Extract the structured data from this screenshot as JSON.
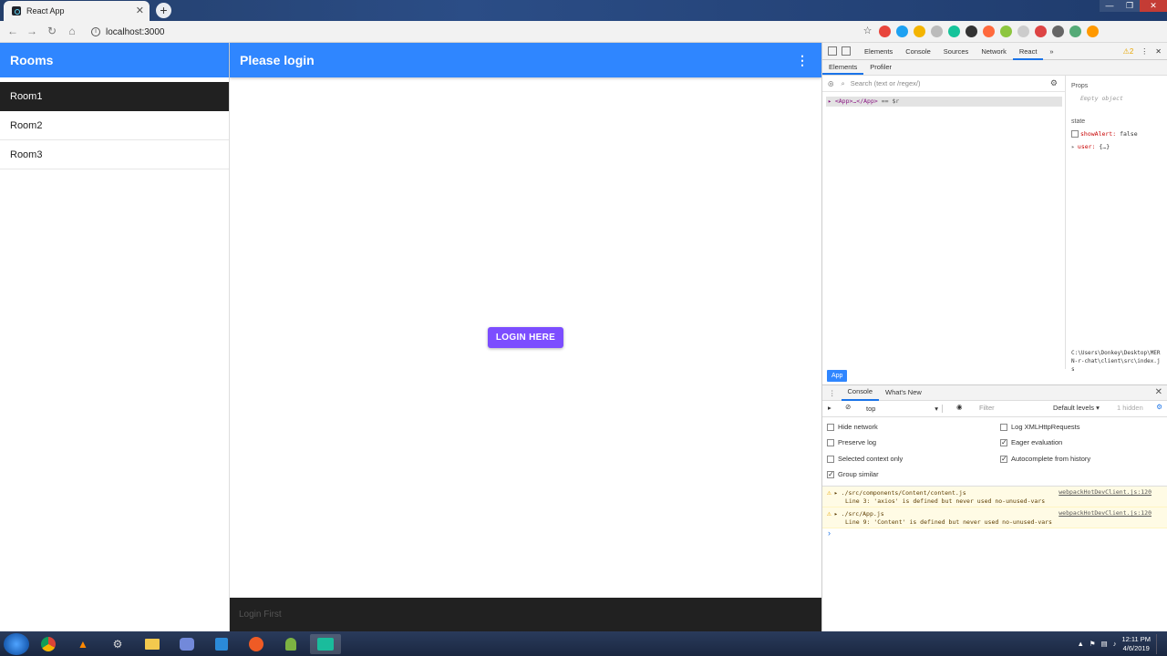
{
  "browser": {
    "tab_title": "React App",
    "tab_close": "✕",
    "new_tab": "+",
    "url": "localhost:3000",
    "window_controls": [
      "—",
      "❐",
      "✕"
    ]
  },
  "app": {
    "sidebar": {
      "title": "Rooms",
      "rooms": [
        "Room1",
        "Room2",
        "Room3"
      ],
      "active_index": 0
    },
    "main": {
      "title": "Please login",
      "login_button": "LOGIN HERE",
      "footer_text": "Login First"
    },
    "colors": {
      "header_blue": "#2f86ff",
      "button_purple": "#7c4dff",
      "dark": "#212121"
    }
  },
  "devtools": {
    "tabs": [
      "Elements",
      "Console",
      "Sources",
      "Network",
      "React"
    ],
    "active_tab": "React",
    "warning_count": "2",
    "react_subtabs": [
      "Elements",
      "Profiler"
    ],
    "search_placeholder": "Search (text or /regex/)",
    "tree_row": "<App>…</App>",
    "tree_row_suffix": "== $r",
    "props_header": "Props",
    "props_empty": "Empty object",
    "state_header": "state",
    "state_showAlert_key": "showAlert:",
    "state_showAlert_val": "false",
    "state_user_key": "user:",
    "state_user_val": "{…}",
    "source_path": "C:\\Users\\Donkey\\Desktop\\MERN-r-chat\\client\\src\\index.js",
    "app_badge": "App",
    "console": {
      "tabs": [
        "Console",
        "What's New"
      ],
      "context": "top",
      "filter_placeholder": "Filter",
      "levels": "Default levels ▾",
      "hidden": "1 hidden",
      "options_left": [
        {
          "label": "Hide network",
          "checked": false
        },
        {
          "label": "Preserve log",
          "checked": false
        },
        {
          "label": "Selected context only",
          "checked": false
        },
        {
          "label": "Group similar",
          "checked": true
        }
      ],
      "options_right": [
        {
          "label": "Log XMLHttpRequests",
          "checked": false
        },
        {
          "label": "Eager evaluation",
          "checked": true
        },
        {
          "label": "Autocomplete from history",
          "checked": true
        }
      ],
      "messages": [
        {
          "file": "./src/components/Content/content.js",
          "source": "webpackHotDevClient.js:120",
          "detail": "Line 3:  'axios' is defined but never used  no-unused-vars"
        },
        {
          "file": "./src/App.js",
          "source": "webpackHotDevClient.js:120",
          "detail": "Line 9:  'Content' is defined but never used  no-unused-vars"
        }
      ],
      "prompt": "›"
    }
  },
  "taskbar": {
    "time": "12:11 PM",
    "date": "4/6/2019"
  }
}
